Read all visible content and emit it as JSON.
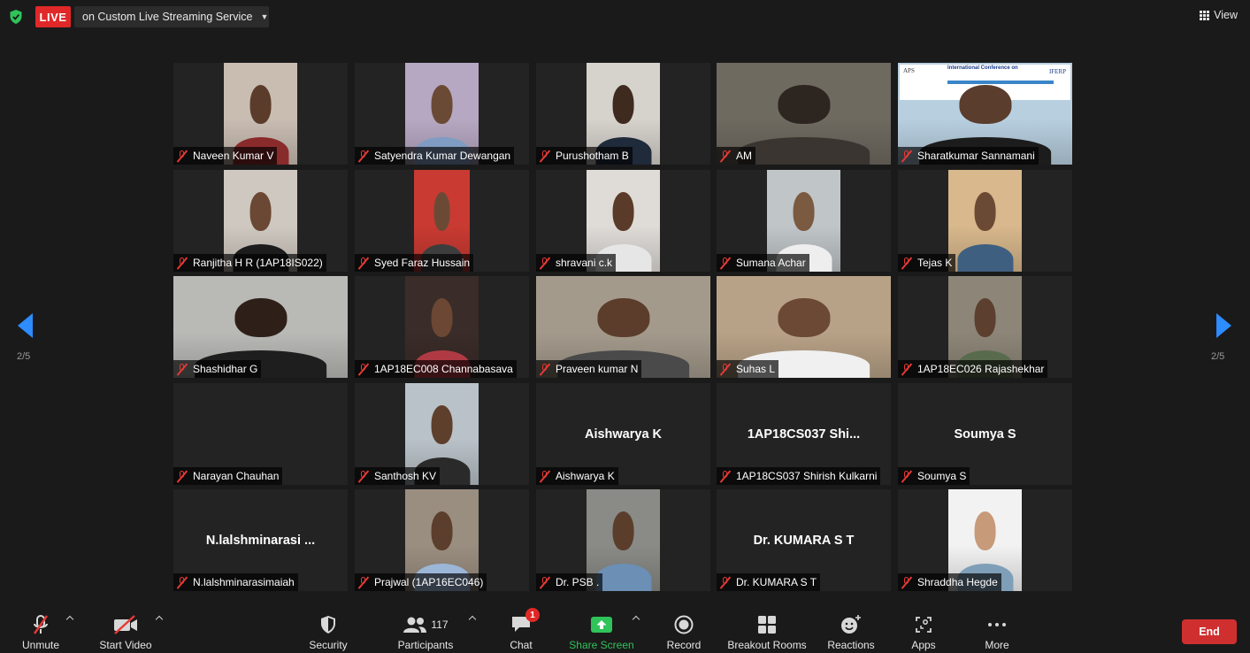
{
  "top_bar": {
    "live_label": "LIVE",
    "stream_label": "on Custom Live Streaming Service",
    "view_label": "View"
  },
  "pagination": {
    "left_text": "2/5",
    "right_text": "2/5"
  },
  "tiles": [
    {
      "name": "Naveen Kumar V",
      "video": true
    },
    {
      "name": "Satyendra Kumar Dewangan",
      "video": true
    },
    {
      "name": "Purushotham B",
      "video": true
    },
    {
      "name": "AM",
      "video": true
    },
    {
      "name": "Sharatkumar Sannamani",
      "video": true
    },
    {
      "name": "Ranjitha H R (1AP18IS022)",
      "video": true
    },
    {
      "name": "Syed Faraz Hussain",
      "video": true
    },
    {
      "name": "shravani c.k",
      "video": true
    },
    {
      "name": "Sumana Achar",
      "video": true
    },
    {
      "name": "Tejas K",
      "video": true
    },
    {
      "name": "Shashidhar G",
      "video": true
    },
    {
      "name": "1AP18EC008 Channabasava",
      "video": true
    },
    {
      "name": "Praveen kumar N",
      "video": true
    },
    {
      "name": "Suhas L",
      "video": true
    },
    {
      "name": "1AP18EC026 Rajashekhar",
      "video": true
    },
    {
      "name": "Narayan Chauhan",
      "video": false
    },
    {
      "name": "Santhosh KV",
      "video": true
    },
    {
      "name": "Aishwarya K",
      "video": false,
      "display_name": "Aishwarya K"
    },
    {
      "name": "1AP18CS037 Shirish Kulkarni",
      "video": false,
      "display_name": "1AP18CS037  Shi..."
    },
    {
      "name": "Soumya S",
      "video": false,
      "display_name": "Soumya S"
    },
    {
      "name": "N.lalshminarasimaiah",
      "video": false,
      "display_name": "N.lalshminarasi ..."
    },
    {
      "name": "Prajwal (1AP16EC046)",
      "video": true
    },
    {
      "name": "Dr. PSB .",
      "video": true
    },
    {
      "name": "Dr. KUMARA S T",
      "video": false,
      "display_name": "Dr. KUMARA S T"
    },
    {
      "name": "Shraddha Hegde",
      "video": true
    }
  ],
  "slide": {
    "aps": "APS",
    "conference": "International Conference on",
    "iferp": "IFERP"
  },
  "toolbar": {
    "unmute": "Unmute",
    "start_video": "Start Video",
    "security": "Security",
    "participants": "Participants",
    "participants_count": "117",
    "chat": "Chat",
    "chat_badge": "1",
    "share_screen": "Share Screen",
    "record": "Record",
    "breakout_rooms": "Breakout Rooms",
    "reactions": "Reactions",
    "apps": "Apps",
    "more": "More",
    "end": "End"
  },
  "colors": {
    "live_red": "#e02828",
    "accent_blue": "#2d8cff",
    "share_green": "#2fc35a",
    "muted_mic_red": "#e53935",
    "end_red": "#d02f2f"
  }
}
